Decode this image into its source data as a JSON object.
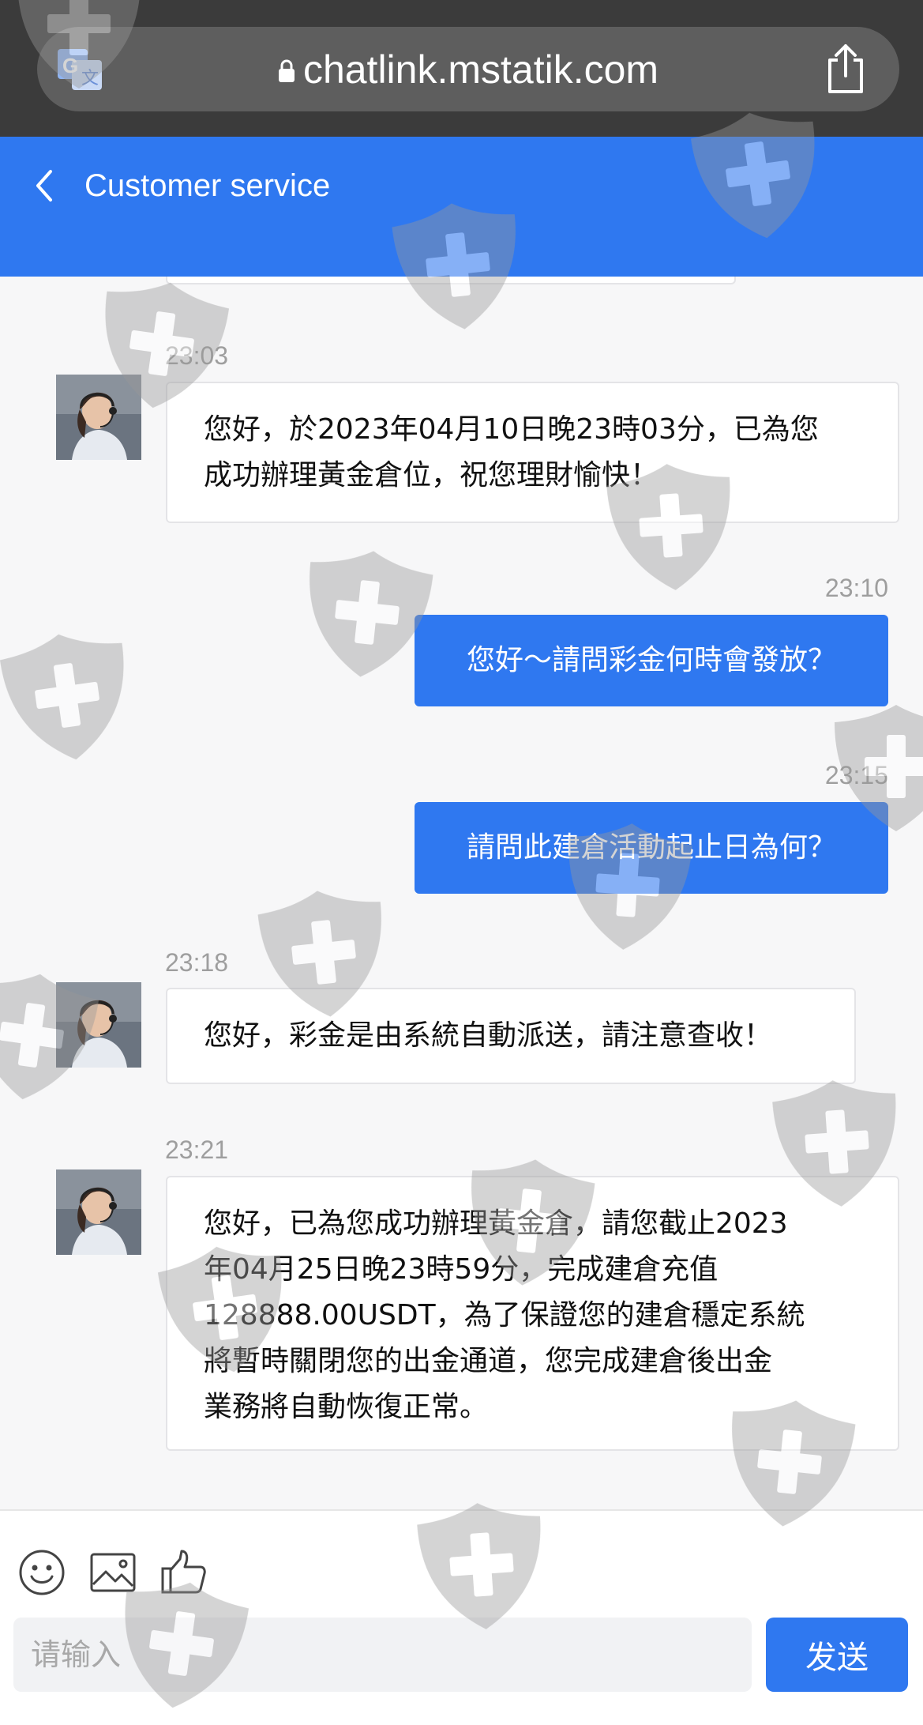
{
  "browser": {
    "url": "chatlink.mstatik.com"
  },
  "header": {
    "title": "Customer service",
    "accent_color": "#2f78f0"
  },
  "messages": [
    {
      "direction": "in",
      "time": "23:03",
      "text_lines": [
        "您好，於2023年04月10日晚23時03分，已為您",
        "成功辦理黃金倉位，祝您理財愉快！"
      ]
    },
    {
      "direction": "out",
      "time": "23:10",
      "text": "您好～請問彩金何時會發放？"
    },
    {
      "direction": "out",
      "time": "23:15",
      "text": "請問此建倉活動起止日為何？"
    },
    {
      "direction": "in",
      "time": "23:18",
      "text_lines": [
        "您好，彩金是由系統自動派送，請注意查收！"
      ]
    },
    {
      "direction": "in",
      "time": "23:21",
      "text_lines": [
        "您好，已為您成功辦理黃金倉，請您截止2023",
        "年04月25日晚23時59分，完成建倉充值",
        "128888.00USDT，為了保證您的建倉穩定系統",
        "將暫時關閉您的出金通道，您完成建倉後出金",
        "業務將自動恢復正常。"
      ]
    }
  ],
  "toolbar": {
    "icons": [
      "smiley-icon",
      "image-icon",
      "thumbs-up-icon"
    ]
  },
  "composer": {
    "placeholder": "请输入",
    "send_label": "发送"
  }
}
